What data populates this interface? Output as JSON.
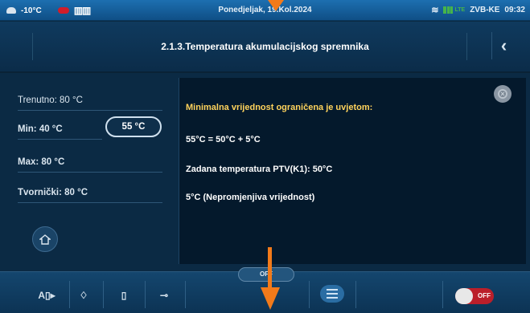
{
  "status_bar": {
    "outdoor_temp": "-10°C",
    "datetime": "Ponedjeljak, 19.Kol.2024",
    "network": "ZVB-KE",
    "time": "09:32",
    "icons": [
      "cloud-icon",
      "alarm-icon",
      "heater-icon",
      "wifi-icon",
      "signal-icon"
    ],
    "lte": "LTE"
  },
  "title": {
    "text": "2.1.3.Temperatura akumulacijskog spremnika",
    "back_icon": "chevron-left-icon"
  },
  "params": {
    "current": "Trenutno: 80 °C",
    "min": "Min: 40 °C",
    "max": "Max: 80 °C",
    "factory": "Tvornički: 80 °C",
    "value": "55 °C"
  },
  "info": {
    "heading": "Minimalna vrijednost ograničena je uvjetom:",
    "line1": "55°C = 50°C + 5°C",
    "line2": "Zadana temperatura PTV(K1): 50°C",
    "line3": "5°C (Nepromjenjiva vrijednost)"
  },
  "bottom_bar": {
    "off_label": "OFF",
    "toggle_label": "OFF",
    "buttons": [
      "auto-mode-icon",
      "flame-icon",
      "boiler-icon",
      "pump-icon",
      "menu-icon"
    ]
  },
  "colors": {
    "accent_orange": "#f27a1a",
    "background": "#0b2a44",
    "info_bg": "#04192c",
    "toggle_red": "#bb1f2a"
  }
}
